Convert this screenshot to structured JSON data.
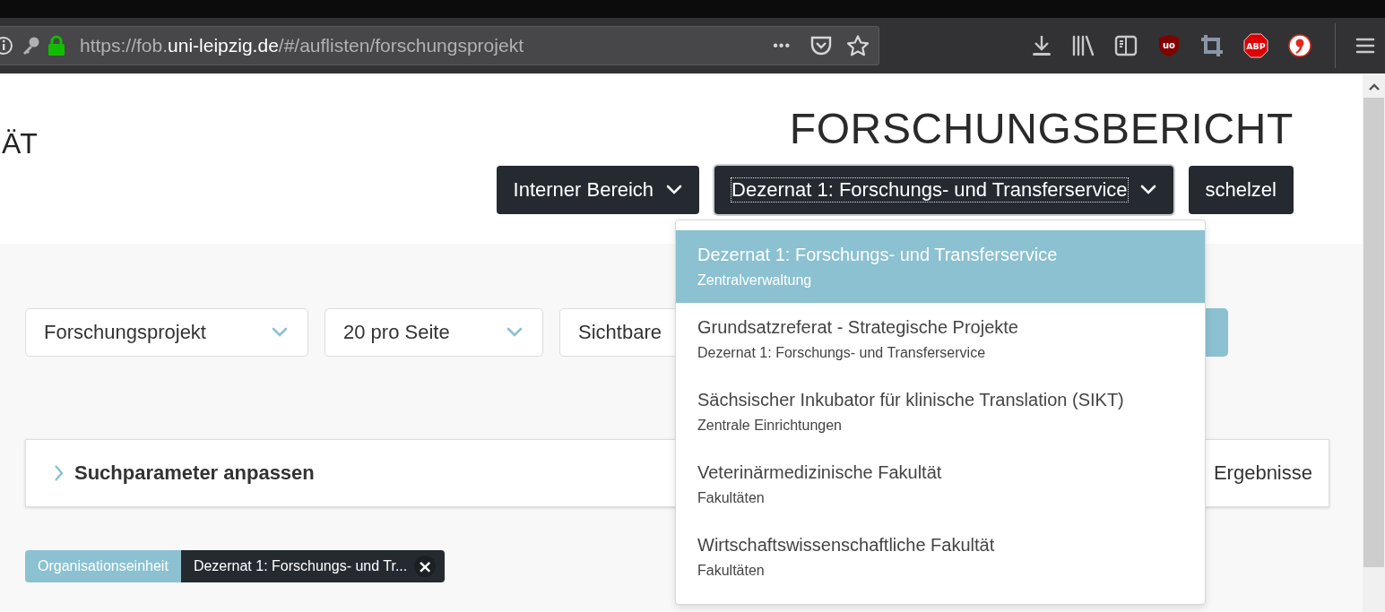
{
  "browser": {
    "url_scheme_host": "https://fob.",
    "url_domain": "uni-leipzig.de",
    "url_path": "/#/auflisten/forschungsprojekt",
    "page_actions": "•••",
    "adblock_badge": "ABP",
    "ublock_badge": "uo"
  },
  "header": {
    "logo_fragment": "ÄT",
    "title": "FORSCHUNGSBERICHT",
    "nav_buttons": [
      {
        "label": "Interner Bereich",
        "focused": false,
        "has_caret": true
      },
      {
        "label": "Dezernat 1: Forschungs- und Transferservice",
        "focused": true,
        "has_caret": true
      },
      {
        "label": "schelzel",
        "focused": false,
        "has_caret": false
      }
    ]
  },
  "org_menu": {
    "items": [
      {
        "title": "Dezernat 1: Forschungs- und Transferservice",
        "subtitle": "Zentralverwaltung",
        "selected": true
      },
      {
        "title": "Grundsatzreferat - Strategische Projekte",
        "subtitle": "Dezernat 1: Forschungs- und Transferservice",
        "selected": false
      },
      {
        "title": "Sächsischer Inkubator für klinische Translation (SIKT)",
        "subtitle": "Zentrale Einrichtungen",
        "selected": false
      },
      {
        "title": "Veterinärmedizinische Fakultät",
        "subtitle": "Fakultäten",
        "selected": false
      },
      {
        "title": "Wirtschaftswissenschaftliche Fakultät",
        "subtitle": "Fakultäten",
        "selected": false
      }
    ]
  },
  "filters": {
    "selects": [
      {
        "value": "Forschungsprojekt",
        "has_caret": true
      },
      {
        "value": "20 pro Seite",
        "has_caret": true
      },
      {
        "value": "Sichtbare",
        "has_caret": false
      }
    ],
    "search_button_visible": true
  },
  "search_panel": {
    "title": "Suchparameter anpassen",
    "expanded": false,
    "results": "Ergebnisse"
  },
  "active_filter": {
    "label": "Organisationseinheit",
    "value": "Dezernat 1: Forschungs- und Tr...",
    "remove": "×"
  }
}
